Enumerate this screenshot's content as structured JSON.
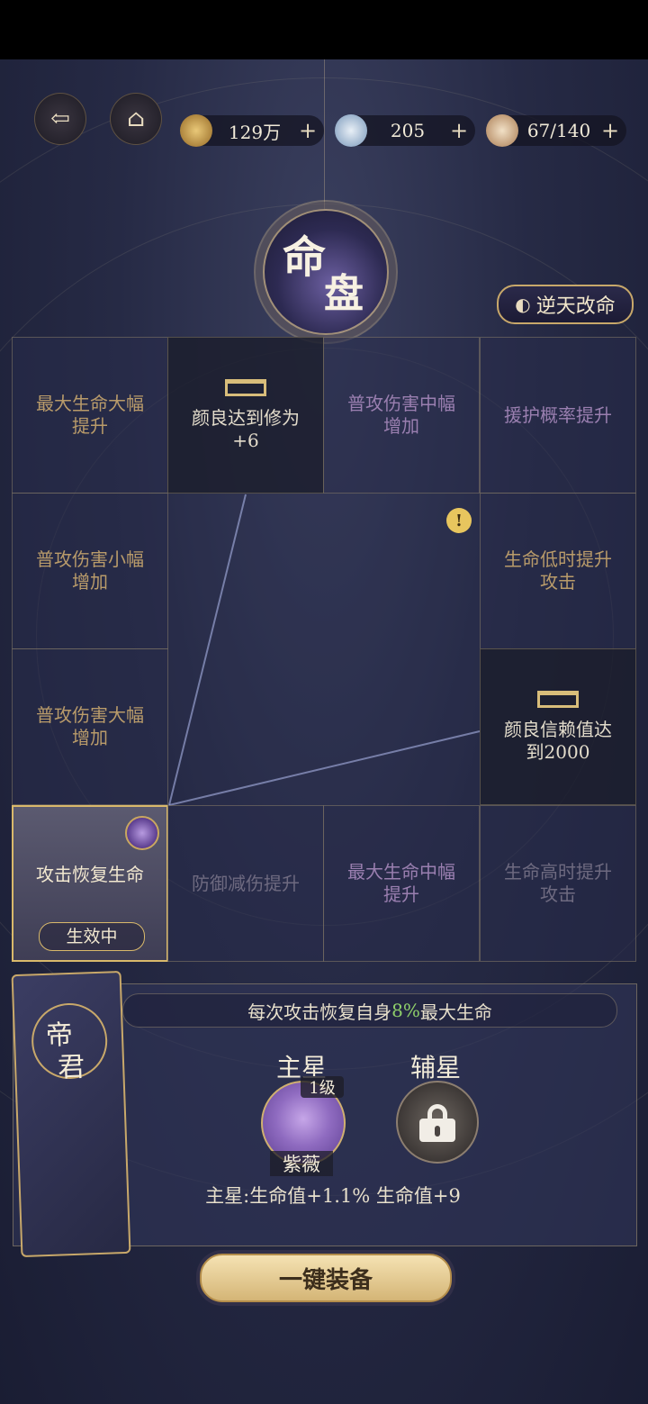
{
  "header": {
    "back_icon": "back-arrow-icon",
    "home_icon": "pavilion-icon",
    "resources": [
      {
        "icon": "copper-coin-icon",
        "value": "129万"
      },
      {
        "icon": "jade-orb-icon",
        "value": "205"
      },
      {
        "icon": "food-bowl-icon",
        "value": "67/140"
      }
    ],
    "plus_symbol": "+"
  },
  "title": {
    "char1": "命",
    "char2": "盘"
  },
  "ntgm_button": {
    "label": "逆天改命",
    "icon": "swirl-icon"
  },
  "grid": {
    "cells": [
      {
        "text": "最大生命大幅提升",
        "color": "#b99b6a",
        "state": "normal"
      },
      {
        "text": "颜良达到修为+6",
        "color": "#e3dccb",
        "state": "locked"
      },
      {
        "text": "普攻伤害中幅增加",
        "color": "#9a7fb0",
        "state": "normal"
      },
      {
        "text": "援护概率提升",
        "color": "#9a7fb0",
        "state": "normal"
      },
      {
        "text": "普攻伤害小幅增加",
        "color": "#b99b6a",
        "state": "normal"
      },
      {
        "text": "生命低时提升攻击",
        "color": "#b99b6a",
        "state": "normal"
      },
      {
        "text": "普攻伤害大幅增加",
        "color": "#b99b6a",
        "state": "normal"
      },
      {
        "text": "颜良信赖值达到2000",
        "color": "#e3dccb",
        "state": "locked"
      },
      {
        "text": "攻击恢复生命",
        "color": "#f2e8d0",
        "state": "active"
      },
      {
        "text": "防御减伤提升",
        "color": "#6e6a80",
        "state": "normal"
      },
      {
        "text": "最大生命中幅提升",
        "color": "#9a7fb0",
        "state": "normal"
      },
      {
        "text": "生命高时提升攻击",
        "color": "#6e6a80",
        "state": "normal"
      }
    ],
    "active_badge": "生效中",
    "warning_symbol": "!"
  },
  "panel": {
    "scroll_char1": "帝",
    "scroll_char2": "君",
    "desc_pre": "每次攻击恢复自身",
    "desc_highlight": "8%",
    "desc_post": "最大生命",
    "main_star_title": "主星",
    "sub_star_title": "辅星",
    "level": "1级",
    "main_star_name": "紫薇",
    "stats": "主星:生命值+1.1% 生命值+9"
  },
  "equip_button": {
    "label": "一键装备"
  }
}
